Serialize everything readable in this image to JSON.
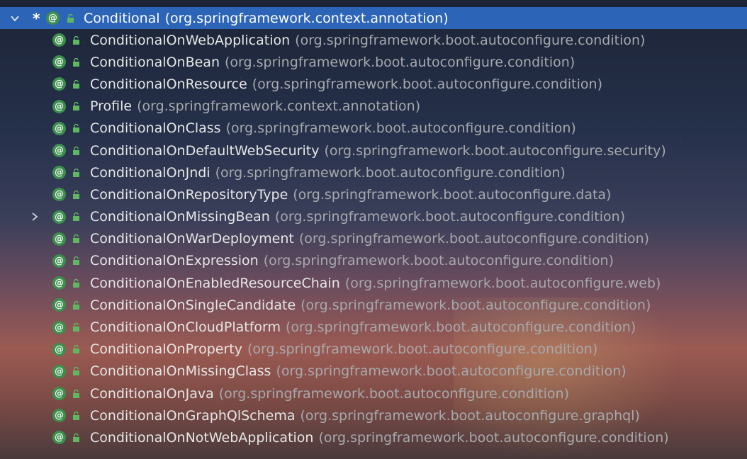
{
  "tree": {
    "root": {
      "name": "Conditional",
      "package": "(org.springframework.context.annotation)",
      "marker": "*",
      "expanded": true
    },
    "children": [
      {
        "name": "ConditionalOnWebApplication",
        "package": "(org.springframework.boot.autoconfigure.condition)"
      },
      {
        "name": "ConditionalOnBean",
        "package": "(org.springframework.boot.autoconfigure.condition)"
      },
      {
        "name": "ConditionalOnResource",
        "package": "(org.springframework.boot.autoconfigure.condition)"
      },
      {
        "name": "Profile",
        "package": "(org.springframework.context.annotation)"
      },
      {
        "name": "ConditionalOnClass",
        "package": "(org.springframework.boot.autoconfigure.condition)"
      },
      {
        "name": "ConditionalOnDefaultWebSecurity",
        "package": "(org.springframework.boot.autoconfigure.security)"
      },
      {
        "name": "ConditionalOnJndi",
        "package": "(org.springframework.boot.autoconfigure.condition)"
      },
      {
        "name": "ConditionalOnRepositoryType",
        "package": "(org.springframework.boot.autoconfigure.data)"
      },
      {
        "name": "ConditionalOnMissingBean",
        "package": "(org.springframework.boot.autoconfigure.condition)",
        "has_children": true
      },
      {
        "name": "ConditionalOnWarDeployment",
        "package": "(org.springframework.boot.autoconfigure.condition)"
      },
      {
        "name": "ConditionalOnExpression",
        "package": "(org.springframework.boot.autoconfigure.condition)"
      },
      {
        "name": "ConditionalOnEnabledResourceChain",
        "package": "(org.springframework.boot.autoconfigure.web)"
      },
      {
        "name": "ConditionalOnSingleCandidate",
        "package": "(org.springframework.boot.autoconfigure.condition)"
      },
      {
        "name": "ConditionalOnCloudPlatform",
        "package": "(org.springframework.boot.autoconfigure.condition)"
      },
      {
        "name": "ConditionalOnProperty",
        "package": "(org.springframework.boot.autoconfigure.condition)"
      },
      {
        "name": "ConditionalOnMissingClass",
        "package": "(org.springframework.boot.autoconfigure.condition)"
      },
      {
        "name": "ConditionalOnJava",
        "package": "(org.springframework.boot.autoconfigure.condition)"
      },
      {
        "name": "ConditionalOnGraphQlSchema",
        "package": "(org.springframework.boot.autoconfigure.graphql)"
      },
      {
        "name": "ConditionalOnNotWebApplication",
        "package": "(org.springframework.boot.autoconfigure.condition)"
      }
    ]
  },
  "icons": {
    "annotation": "annotation-icon",
    "lock": "lock-icon",
    "expand": "chevron-down-icon",
    "collapse": "chevron-right-icon"
  },
  "colors": {
    "selection": "#2c64b8",
    "annotation_icon": "#3d8f4e",
    "lock_icon": "#5fb85f",
    "name_text": "#e6e6e6",
    "package_text": "#a7a9ad"
  }
}
